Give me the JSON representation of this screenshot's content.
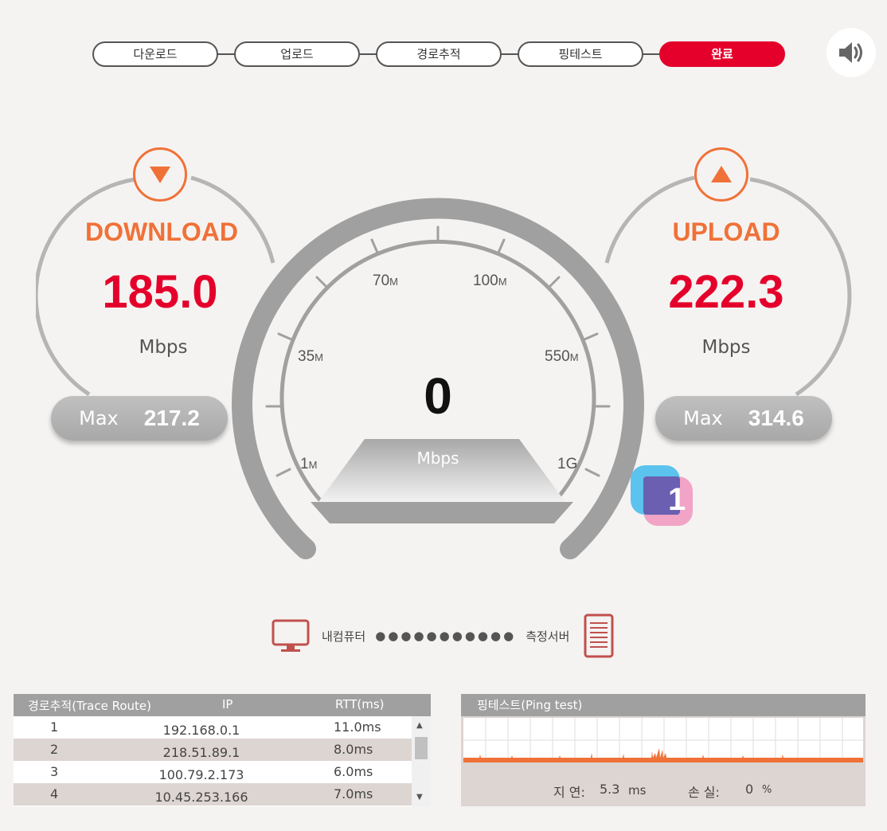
{
  "stepper": {
    "steps": [
      "다운로드",
      "업로드",
      "경로추적",
      "핑테스트",
      "완료"
    ],
    "active_index": 4
  },
  "sound": {
    "icon": "speaker-icon"
  },
  "download": {
    "title": "DOWNLOAD",
    "value": "185.0",
    "unit": "Mbps",
    "max_label": "Max",
    "max_value": "217.2",
    "icon": "arrow-down-icon"
  },
  "upload": {
    "title": "UPLOAD",
    "value": "222.3",
    "unit": "Mbps",
    "max_label": "Max",
    "max_value": "314.6",
    "icon": "arrow-up-icon"
  },
  "gauge": {
    "value": "0",
    "unit": "Mbps",
    "ticks": [
      {
        "num": "1",
        "suffix": "M"
      },
      {
        "num": "35",
        "suffix": "M"
      },
      {
        "num": "70",
        "suffix": "M"
      },
      {
        "num": "100",
        "suffix": "M"
      },
      {
        "num": "550",
        "suffix": "M"
      },
      {
        "num": "1G",
        "suffix": ""
      }
    ]
  },
  "badge": {
    "text": "1"
  },
  "connection": {
    "client_label": "내컴퓨터",
    "dots": "●●●●●●●●●●●",
    "server_label": "측정서버"
  },
  "trace": {
    "headers": [
      "경로추적(Trace Route)",
      "IP",
      "RTT(ms)"
    ],
    "rows": [
      {
        "num": "1",
        "ip": "192.168.0.1",
        "rtt": "11.0ms"
      },
      {
        "num": "2",
        "ip": "218.51.89.1",
        "rtt": "8.0ms"
      },
      {
        "num": "3",
        "ip": "100.79.2.173",
        "rtt": "6.0ms"
      },
      {
        "num": "4",
        "ip": "10.45.253.166",
        "rtt": "7.0ms"
      }
    ]
  },
  "ping": {
    "title": "핑테스트(Ping test)",
    "latency_label": "지 연:",
    "latency_value": "5.3",
    "latency_unit": "ms",
    "loss_label": "손 실:",
    "loss_value": "0",
    "loss_unit": "%"
  },
  "colors": {
    "accent_red": "#e4002b",
    "accent_orange": "#f07138",
    "gauge_gray": "#a0a0a0",
    "table_header": "#a0a0a0",
    "row_alt": "#ddd5d2"
  }
}
